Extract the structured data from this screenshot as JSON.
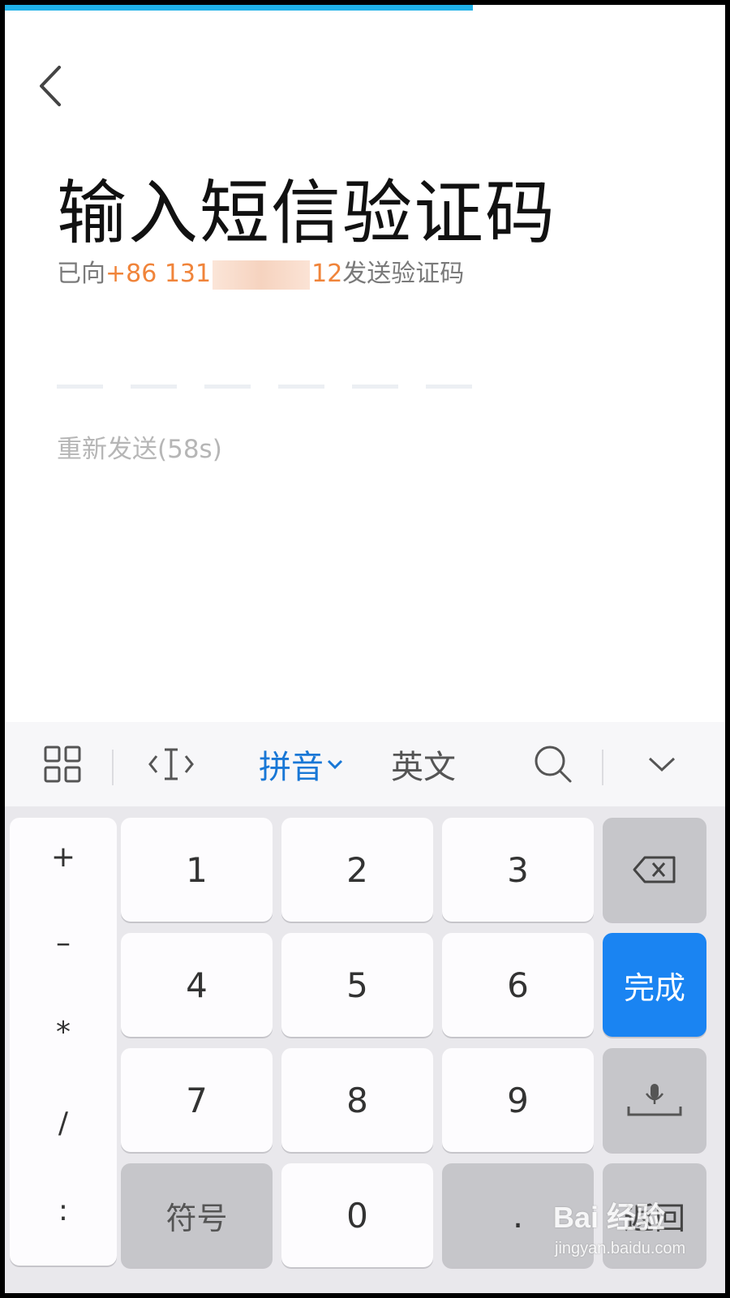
{
  "colors": {
    "accent_blue": "#1a84f2",
    "phone_orange": "#f0843a",
    "progress": "#1fb1e8"
  },
  "progress": {
    "fraction": 0.65
  },
  "header": {
    "back_icon": "chevron-left-icon"
  },
  "page": {
    "title": "输入短信验证码",
    "subtitle_prefix": "已向",
    "phone_prefix": "+86 131",
    "phone_suffix": "12",
    "subtitle_suffix": "发送验证码",
    "resend": "重新发送(58s)"
  },
  "code": {
    "slots": 6
  },
  "keyboard": {
    "toolbar": {
      "grid_icon": "grid-icon",
      "cursor_icon": "text-cursor-icon",
      "pinyin": "拼音",
      "english": "英文",
      "search_icon": "search-icon",
      "collapse_icon": "chevron-down-icon"
    },
    "symbols": [
      "+",
      "–",
      "*",
      "/",
      ":"
    ],
    "digits": [
      "1",
      "2",
      "3",
      "4",
      "5",
      "6",
      "7",
      "8",
      "9"
    ],
    "zero": "0",
    "symbols_key": "符号",
    "dot": ".",
    "done": "完成",
    "return": "返回",
    "backspace_icon": "backspace-icon",
    "voice_icon": "microphone-space-icon"
  },
  "watermark": {
    "logo": "Bai 经验",
    "url": "jingyan.baidu.com"
  }
}
